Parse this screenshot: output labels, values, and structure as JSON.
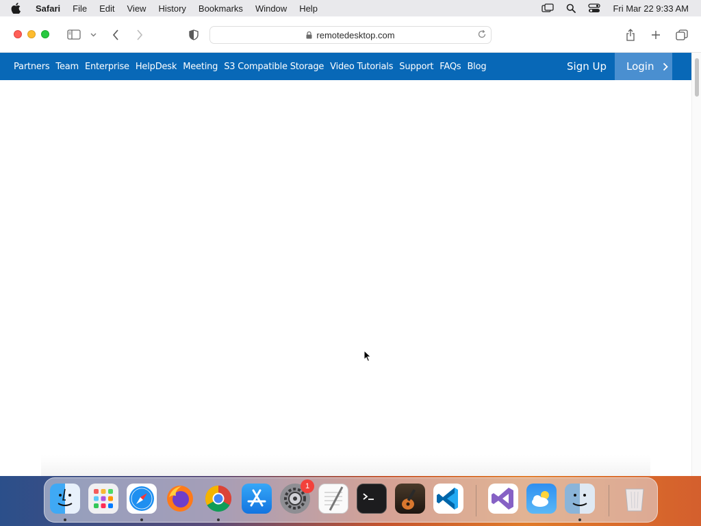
{
  "menubar": {
    "app_name": "Safari",
    "items": [
      "File",
      "Edit",
      "View",
      "History",
      "Bookmarks",
      "Window",
      "Help"
    ],
    "clock": "Fri Mar 22  9:33 AM"
  },
  "browser": {
    "url": "remotedesktop.com"
  },
  "site": {
    "nav_links": [
      "Partners",
      "Team",
      "Enterprise",
      "HelpDesk",
      "Meeting",
      "S3 Compatible Storage",
      "Video Tutorials",
      "Support",
      "FAQs",
      "Blog"
    ],
    "signup_label": "Sign Up",
    "login_label": "Login"
  },
  "dock": {
    "apps": [
      "Finder",
      "Launchpad",
      "Safari",
      "Firefox",
      "Chrome",
      "App Store",
      "System Preferences",
      "TextEdit",
      "Terminal",
      "GarageBand",
      "Visual Studio Code",
      "Visual Studio",
      "Weather",
      "Finder",
      "Trash"
    ],
    "settings_badge": "1"
  },
  "colors": {
    "site_nav_bg": "#0868b7",
    "login_bg": "#4a8fd0"
  }
}
